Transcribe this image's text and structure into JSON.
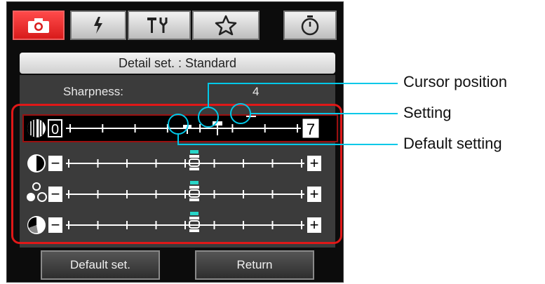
{
  "tabs": [
    {
      "name": "camera-icon",
      "active": true
    },
    {
      "name": "flash-icon",
      "active": false
    },
    {
      "name": "tools-icon",
      "active": false
    },
    {
      "name": "star-icon",
      "active": false
    },
    {
      "name": "timer-icon",
      "active": false
    }
  ],
  "header": {
    "title": "Detail set. : Standard"
  },
  "sharpness": {
    "label": "Sharpness:",
    "value": "4"
  },
  "sliders": [
    {
      "icon": "sharpness-icon",
      "min_label": "0",
      "max_label": "7",
      "steps": 8,
      "current": 4,
      "default": 3,
      "selected": true
    },
    {
      "icon": "contrast-icon",
      "min_label": "−",
      "max_label": "+",
      "steps": 9,
      "current": 4,
      "default": 4,
      "selected": false
    },
    {
      "icon": "saturation-icon",
      "min_label": "−",
      "max_label": "+",
      "steps": 9,
      "current": 4,
      "default": 4,
      "selected": false
    },
    {
      "icon": "color-tone-icon",
      "min_label": "−",
      "max_label": "+",
      "steps": 9,
      "current": 4,
      "default": 4,
      "selected": false
    }
  ],
  "buttons": {
    "default_set": "Default set.",
    "return": "Return"
  },
  "annotations": {
    "cursor_position": "Cursor position",
    "setting": "Setting",
    "default_setting": "Default setting"
  },
  "colors": {
    "accent_red": "#e01818",
    "callout_cyan": "#00c8e8"
  }
}
